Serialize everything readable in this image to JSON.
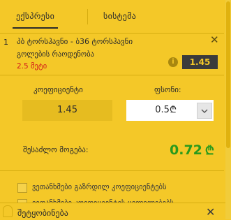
{
  "tabs": [
    {
      "label": "ექსპრესი",
      "active": true
    },
    {
      "label": "სისტემა",
      "active": false
    }
  ],
  "bet": {
    "index": "1",
    "title": "პბ ტორსჰავნი - ბ36 ტორსჰავნი",
    "market": "გოლების რაოდენობა",
    "selection": "2.5 მეტი",
    "odds": "1.45",
    "close_icon": "close-icon",
    "info_icon": "info-icon"
  },
  "odds_section": {
    "label": "კოეფიციენტი",
    "value": "1.45"
  },
  "stake_section": {
    "label": "ფსონი:",
    "value": "0.5",
    "currency": "₾",
    "dropdown_icon": "chevron-down-icon"
  },
  "win": {
    "label": "შესაძლო მოგება:",
    "value": "0.72",
    "currency": "₾"
  },
  "options": [
    {
      "label": "ვეთანხმები გაზრდილ კოეფიციენტებს",
      "checked": false
    },
    {
      "label": "ვეთანხმები კოეფიციენტის ცვლილებებს",
      "checked": false
    }
  ],
  "notification": {
    "title": "შეტყობინება",
    "bell_icon": "bell-icon",
    "close_icon": "close-icon"
  },
  "colors": {
    "background": "#f4c828",
    "accent_dark": "#3b3b3b",
    "win_green": "#2a9a1c",
    "selection_red": "#d31b1b"
  }
}
